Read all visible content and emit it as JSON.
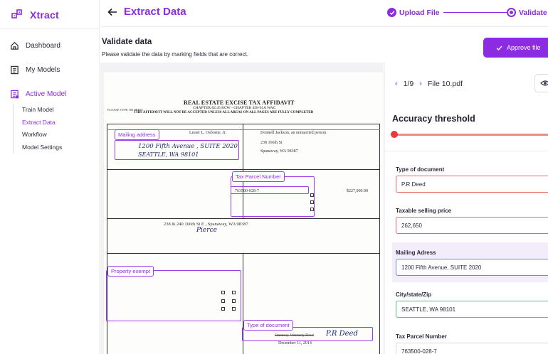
{
  "brand": {
    "name": "Xtract",
    "color": "#8b2be2"
  },
  "sidebar": {
    "items": [
      {
        "label": "Dashboard",
        "icon": "home-icon"
      },
      {
        "label": "My Models",
        "icon": "document-list-icon"
      },
      {
        "label": "Active Model",
        "icon": "active-model-icon"
      }
    ],
    "subitems": [
      {
        "label": "Train Model"
      },
      {
        "label": "Extract Data"
      },
      {
        "label": "Workflow"
      },
      {
        "label": "Model Settings"
      }
    ]
  },
  "header": {
    "title": "Extract Data",
    "steps": [
      {
        "label": "Upload File",
        "state": "complete"
      },
      {
        "label": "Validate",
        "state": "current"
      }
    ]
  },
  "main": {
    "section_title": "Validate data",
    "section_subtitle": "Please validate the data by marking fields that are correct.",
    "approve_label": "Approve file"
  },
  "document": {
    "title": "REAL ESTATE EXCISE TAX AFFIDAVIT",
    "chapter": "CHAPTER 82.45 RCW - CHAPTER 458-61A WAC",
    "notice": "THIS AFFIDAVIT WILL NOT BE ACCEPTED UNLESS ALL AREAS ON ALL PAGES ARE FULLY COMPLETED",
    "please_type": "PLEASE TYPE OR PRINT",
    "seller_name": "Lester L. Osborne, Jr.",
    "buyer_name": "Donnell Jackson, an unmarried person",
    "buyer_address": "238 166th St",
    "buyer_city": "Spanaway, WA 98387",
    "hand_address": "1200 Fifth Avenue , SUITE 2020",
    "hand_city": "SEATTLE, WA 98101",
    "parcel_number": "763500-028-7",
    "assessed_value": "$227,000.00",
    "property_address": "238 & 240 166th St E , Spanaway, WA 98387",
    "hand_county": "Pierce",
    "doc_type": "Statutory Warranty Deed",
    "hand_doc_type": "P.R Deed",
    "doc_date": "December 11, 2014",
    "tags": {
      "mailing": "Mailing address",
      "parcel": "Tax Parcel Number",
      "exempt": "Property exempt",
      "doctype": "Type of document"
    }
  },
  "panel": {
    "page_indicator": "1/9",
    "file_name": "File 10.pdf",
    "accuracy_title": "Accuracy threshold",
    "fields": [
      {
        "label": "Type of document",
        "value": "P.R Deed",
        "status": "invalid"
      },
      {
        "label": "Taxable selling price",
        "value": "262,650",
        "status": "invalid"
      },
      {
        "label": "Mailing Adress",
        "value": "1200 Fifth Avenue, SUITE 2020",
        "status": "selected"
      },
      {
        "label": "City/state/Zip",
        "value": "SEATTLE, WA 98101",
        "status": "valid"
      },
      {
        "label": "Tax Parcel Number",
        "value": "763500-028-7",
        "status": "neutral"
      }
    ]
  },
  "colors": {
    "accent": "#8b2be2",
    "invalid": "#e26a6a",
    "valid": "#5cb88a",
    "selected": "#5b8fd6"
  }
}
